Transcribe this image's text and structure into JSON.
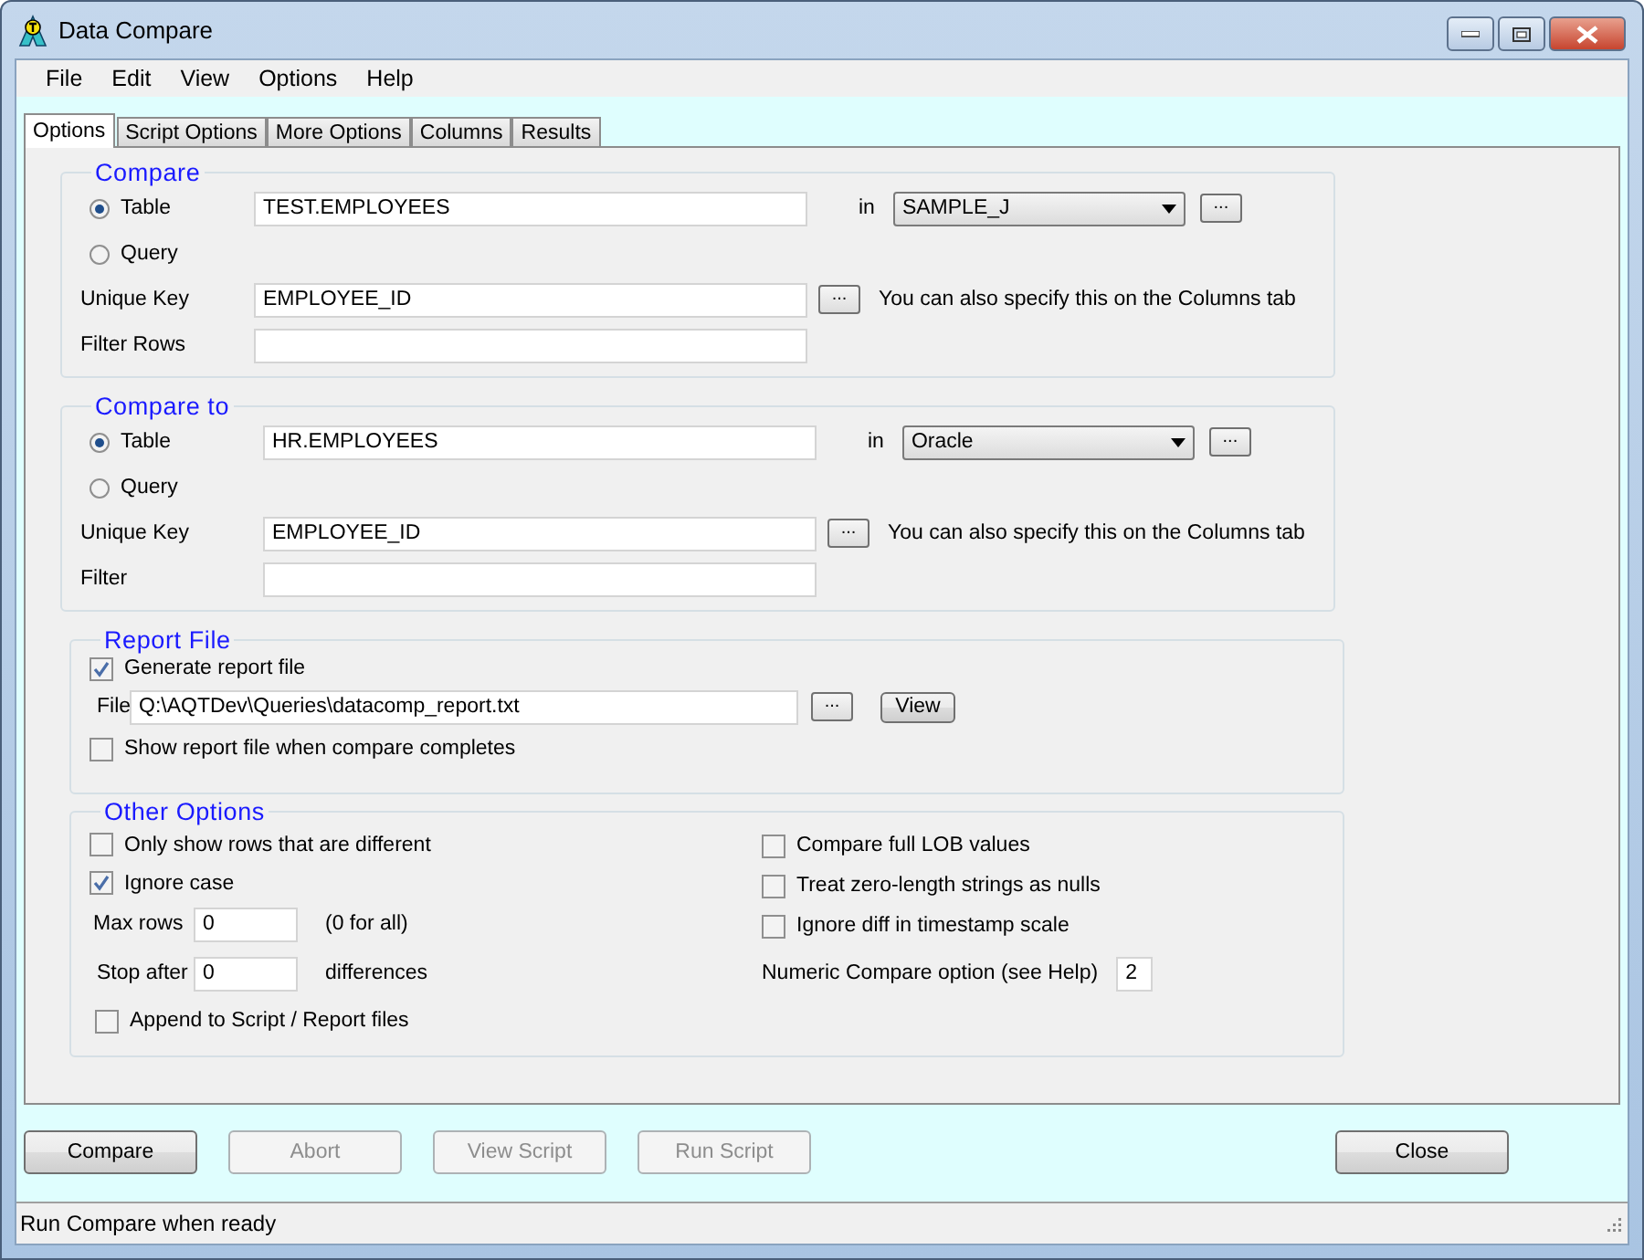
{
  "window": {
    "title": "Data Compare"
  },
  "menu": [
    "File",
    "Edit",
    "View",
    "Options",
    "Help"
  ],
  "tabs": [
    {
      "label": "Options",
      "selected": true
    },
    {
      "label": "Script Options",
      "selected": false
    },
    {
      "label": "More Options",
      "selected": false
    },
    {
      "label": "Columns",
      "selected": false
    },
    {
      "label": "Results",
      "selected": false
    }
  ],
  "compare": {
    "title": "Compare",
    "sources": [
      {
        "label": "Table",
        "selected": true
      },
      {
        "label": "Query",
        "selected": false
      }
    ],
    "table_name": "TEST.EMPLOYEES",
    "in_label": "in",
    "database": "SAMPLE_J",
    "database_browse": "...",
    "unique_key_label": "Unique Key",
    "unique_key": "EMPLOYEE_ID",
    "key_browse": "...",
    "key_hint": "You can also specify this on the Columns tab",
    "filter_label": "Filter Rows"
  },
  "compare_to": {
    "title": "Compare to",
    "sources": [
      {
        "label": "Table",
        "selected": true
      },
      {
        "label": "Query",
        "selected": false
      }
    ],
    "table_name": "HR.EMPLOYEES",
    "in_label": "in",
    "database": "Oracle",
    "database_browse": "...",
    "unique_key_label": "Unique Key",
    "unique_key": "EMPLOYEE_ID",
    "key_browse": "...",
    "key_hint": "You can also specify this on the Columns tab",
    "filter_label": "Filter"
  },
  "report_file": {
    "title": "Report File",
    "generate": {
      "label": "Generate report file",
      "checked": true
    },
    "file_label": "File",
    "file_path": "Q:\\AQTDev\\Queries\\datacomp_report.txt",
    "browse": "...",
    "view_button": "View",
    "show_when_done": {
      "label": "Show report file when compare completes",
      "checked": false
    }
  },
  "other_options": {
    "title": "Other Options",
    "left_checks": [
      {
        "label": "Only show rows that are different",
        "checked": false
      },
      {
        "label": "Ignore case",
        "checked": true
      }
    ],
    "max_rows_label": "Max rows",
    "max_rows": "0",
    "max_rows_note": "(0 for all)",
    "stop_after_label": "Stop after",
    "stop_after": "0",
    "stop_after_note": "differences",
    "append": {
      "label": "Append to Script / Report files",
      "checked": false
    },
    "right_checks": [
      {
        "label": "Compare full LOB values",
        "checked": false
      },
      {
        "label": "Treat zero-length strings as nulls",
        "checked": false
      },
      {
        "label": "Ignore diff in timestamp scale",
        "checked": false
      }
    ],
    "numeric_label": "Numeric Compare option (see Help)",
    "numeric_value": "2"
  },
  "action_buttons": [
    {
      "label": "Compare",
      "disabled": false
    },
    {
      "label": "Abort",
      "disabled": true
    },
    {
      "label": "View Script",
      "disabled": true
    },
    {
      "label": "Run Script",
      "disabled": true
    }
  ],
  "close_button": "Close",
  "status_bar": "Run Compare when ready"
}
